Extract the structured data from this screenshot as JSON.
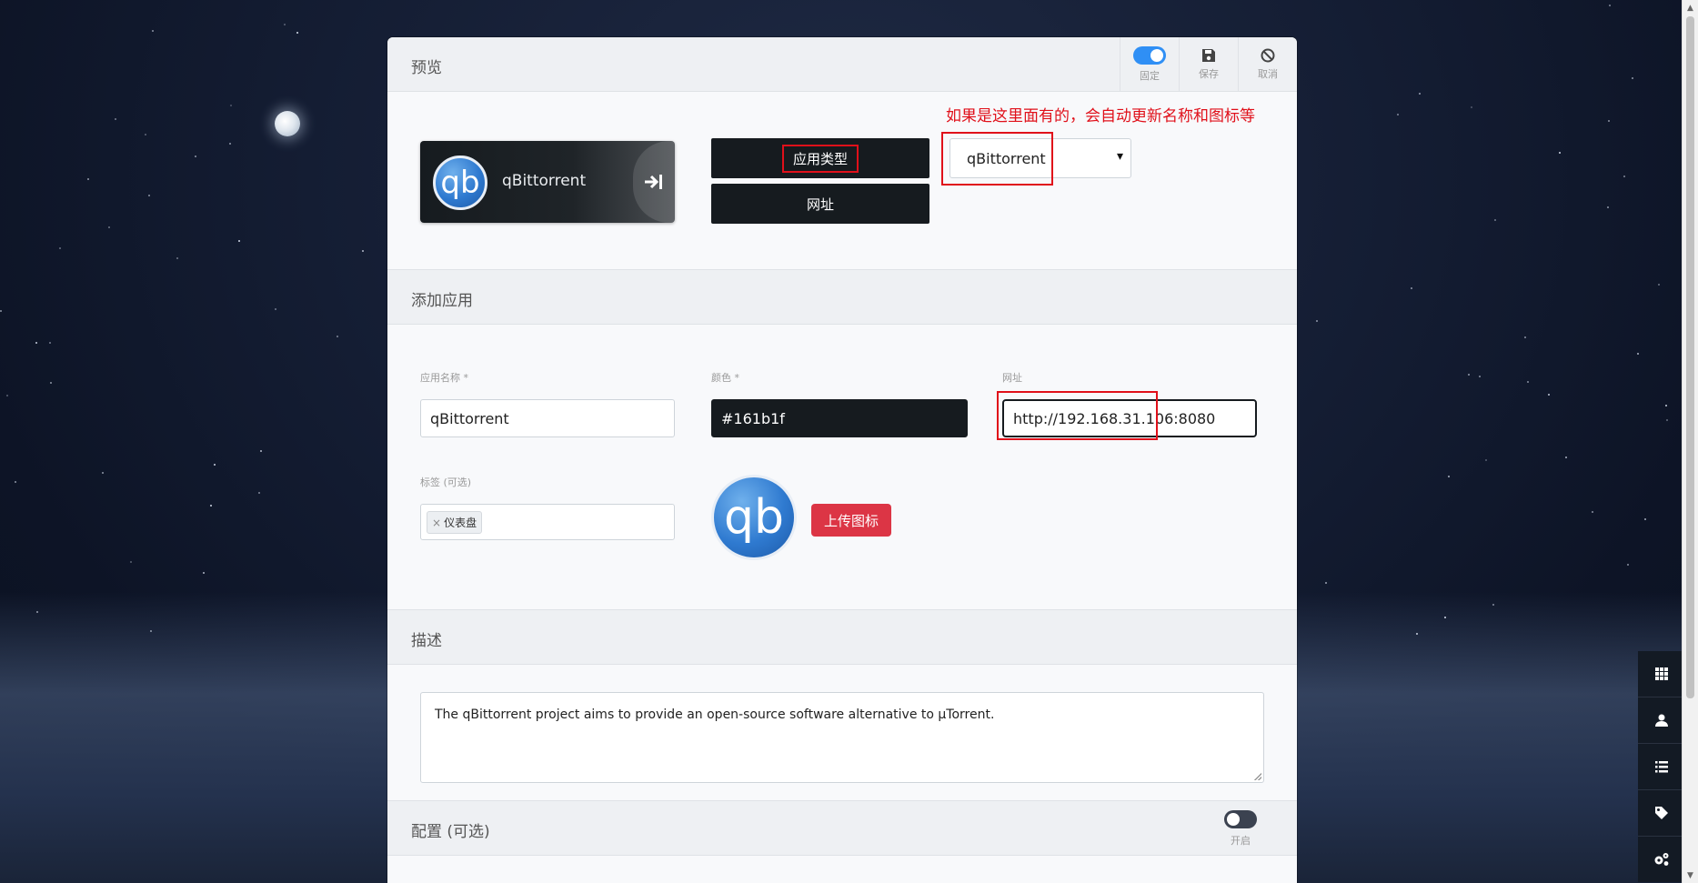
{
  "preview": {
    "title": "预览",
    "pin_label": "固定",
    "save_label": "保存",
    "cancel_label": "取消",
    "app_name": "qBittorrent",
    "logo_text": "qb",
    "app_type_button": "应用类型",
    "url_button": "网址",
    "type_select_value": "qBittorrent",
    "annotation_note": "如果是这里面有的，会自动更新名称和图标等"
  },
  "add_app": {
    "title": "添加应用",
    "name_label": "应用名称 *",
    "name_value": "qBittorrent",
    "color_label": "颜色 *",
    "color_value": "#161b1f",
    "url_label": "网址",
    "url_value": "http://192.168.31.106:8080",
    "tags_label": "标签 (可选)",
    "tags": [
      "仪表盘"
    ],
    "upload_icon_button": "上传图标"
  },
  "description": {
    "title": "描述",
    "text": "The qBittorrent project aims to provide an open-source software alternative to µTorrent."
  },
  "config": {
    "title": "配置 (可选)",
    "toggle_label": "开启",
    "enabled": false
  },
  "colors": {
    "accent": "#2f8ff5",
    "app_color": "#161b1f",
    "danger": "#dc3545",
    "annotation_red": "#e0101a"
  },
  "side_menu": {
    "icons": [
      "grid-icon",
      "user-icon",
      "list-icon",
      "tag-icon",
      "cogs-icon"
    ]
  }
}
